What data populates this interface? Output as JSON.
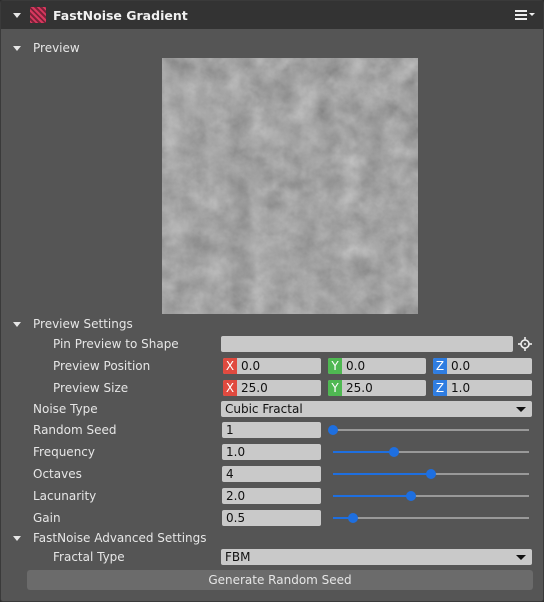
{
  "header": {
    "title": "FastNoise Gradient",
    "menu_icon": "hamburger-menu-icon",
    "logo_icon": "fastnoise-logo-icon"
  },
  "preview": {
    "label": "Preview"
  },
  "preview_settings": {
    "label": "Preview Settings",
    "pin": {
      "label": "Pin Preview to Shape",
      "value": "",
      "icon": "crosshair-icon"
    },
    "position": {
      "label": "Preview Position",
      "x": "0.0",
      "y": "0.0",
      "z": "0.0"
    },
    "size": {
      "label": "Preview Size",
      "x": "25.0",
      "y": "25.0",
      "z": "1.0"
    }
  },
  "axes": {
    "x": "X",
    "y": "Y",
    "z": "Z",
    "x_color": "#e04a3f",
    "y_color": "#4fb852",
    "z_color": "#2f7de1"
  },
  "noise_type": {
    "label": "Noise Type",
    "value": "Cubic Fractal"
  },
  "params": [
    {
      "label": "Random Seed",
      "value": "1",
      "slider": 0.0
    },
    {
      "label": "Frequency",
      "value": "1.0",
      "slider": 0.31
    },
    {
      "label": "Octaves",
      "value": "4",
      "slider": 0.5
    },
    {
      "label": "Lacunarity",
      "value": "2.0",
      "slider": 0.4
    },
    {
      "label": "Gain",
      "value": "0.5",
      "slider": 0.1
    }
  ],
  "advanced": {
    "label": "FastNoise Advanced Settings",
    "fractal_type": {
      "label": "Fractal Type",
      "value": "FBM"
    }
  },
  "generate_button": "Generate Random Seed",
  "accent": "#1e6fe0"
}
